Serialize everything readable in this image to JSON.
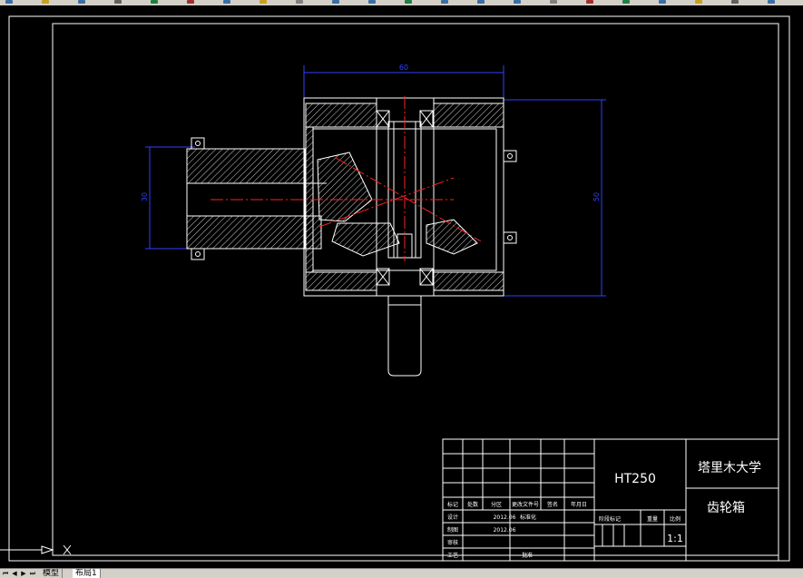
{
  "toolbar": {
    "buttons": [
      "new-icon",
      "open-icon",
      "save-icon",
      "print-icon",
      "preview-icon",
      "cut-icon",
      "copy-icon",
      "paste-icon",
      "match-icon",
      "undo-icon",
      "redo-icon",
      "pan-icon",
      "zoom-realtime-icon",
      "zoom-window-icon",
      "zoom-previous-icon",
      "properties-icon",
      "design-center-icon",
      "tool-palette-icon",
      "sheet-set-icon",
      "markup-icon",
      "calc-icon",
      "help-icon"
    ]
  },
  "drawing": {
    "dimensions": {
      "width_top": "60",
      "height_left": "30",
      "height_right": "50"
    },
    "title_block": {
      "material": "HT250",
      "school": "塔里木大学",
      "part_name": "齿轮箱",
      "scale_label": "比例",
      "scale": "1:1",
      "weight_label": "重量",
      "stage_label": "阶段标记",
      "change_headers": [
        "标记",
        "处数",
        "分区",
        "更改文件号",
        "签名",
        "年月日"
      ],
      "rows": {
        "design": "设计",
        "std": "标准化",
        "date1": "2012.06",
        "date2": "2012.06",
        "draw": "制图",
        "check": "审核",
        "process": "工艺",
        "approve": "批准"
      }
    }
  },
  "tabs": [
    {
      "label": "模型",
      "active": false
    },
    {
      "label": "布局1",
      "active": true
    }
  ]
}
